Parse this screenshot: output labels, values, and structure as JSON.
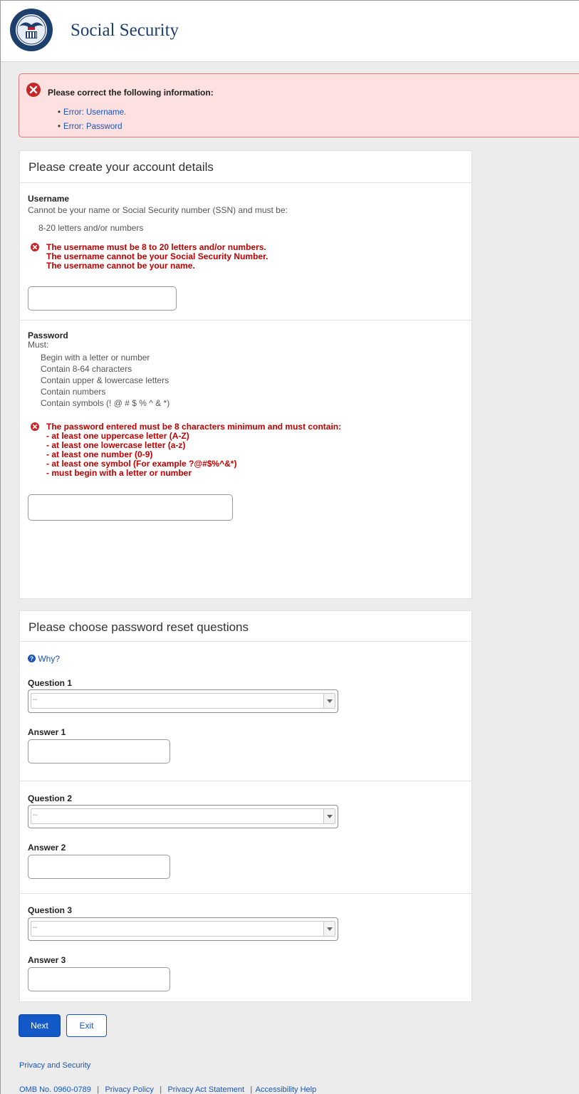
{
  "header": {
    "site_title": "Social Security",
    "logo_text": "SOCIAL SECURITY ADMINISTRATION"
  },
  "alert": {
    "title": "Please correct the following information:",
    "items": [
      "Error: Username.",
      "Error: Password"
    ]
  },
  "account": {
    "title": "Please create your account details",
    "username": {
      "label": "Username",
      "help": "Cannot be your name or Social Security number (SSN) and must be:",
      "rule": "8-20 letters and/or numbers",
      "errors": [
        "The username must be 8 to 20 letters and/or numbers.",
        "The username cannot be your Social Security Number.",
        "The username cannot be your name."
      ],
      "value": ""
    },
    "password": {
      "label": "Password",
      "must": "Must:",
      "rules": [
        "Begin with a letter or number",
        "Contain 8-64 characters",
        "Contain upper & lowercase letters",
        "Contain numbers",
        "Contain symbols (! @ # $ % ^ & *)"
      ],
      "errors": [
        "The password entered must be 8 characters minimum and must contain:",
        "- at least one uppercase letter (A-Z)",
        "- at least one lowercase letter (a-z)",
        "- at least one number (0-9)",
        "- at least one symbol (For example ?@#$%^&*)",
        "- must begin with a letter or number"
      ],
      "value": ""
    }
  },
  "reset": {
    "title": "Please choose password reset questions",
    "why_link": "Why?",
    "questions": [
      {
        "q_label": "Question 1",
        "selected": "--",
        "a_label": "Answer 1",
        "answer": ""
      },
      {
        "q_label": "Question 2",
        "selected": "--",
        "a_label": "Answer 2",
        "answer": ""
      },
      {
        "q_label": "Question 3",
        "selected": "--",
        "a_label": "Answer 3",
        "answer": ""
      }
    ]
  },
  "buttons": {
    "next": "Next",
    "exit": "Exit"
  },
  "footer": {
    "privacy_security": "Privacy and Security",
    "omb": "OMB No. 0960-0789",
    "sep": "|",
    "privacy_policy": "Privacy Policy",
    "privacy_act": "Privacy Act Statement",
    "accessibility": "Accessibility Help"
  },
  "colors": {
    "brand_navy": "#1d3f6e",
    "link_blue": "#1a55b8",
    "error_red": "#c00000",
    "alert_bg": "#fde0e0",
    "primary_button": "#1259c7"
  }
}
